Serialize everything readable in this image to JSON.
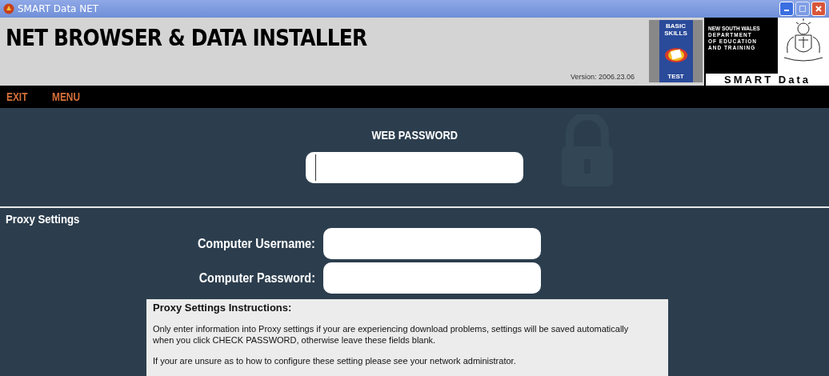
{
  "window": {
    "title": "SMART Data NET"
  },
  "header": {
    "title": "NET BROWSER & DATA INSTALLER",
    "version": "Version: 2006.23.06",
    "badge": {
      "top": "BASIC SKILLS",
      "bottom": "TEST"
    },
    "department": {
      "lines": [
        "NEW SOUTH WALES",
        "DEPARTMENT",
        "OF EDUCATION",
        "AND TRAINING"
      ],
      "product": "SMART Data"
    }
  },
  "menu": [
    "EXIT",
    "MENU"
  ],
  "web_password": {
    "label": "WEB PASSWORD",
    "focused": true
  },
  "proxy": {
    "heading": "Proxy Settings",
    "fields": [
      {
        "label": "Computer Username:"
      },
      {
        "label": "Computer Password:"
      }
    ],
    "instructions": {
      "title": "Proxy Settings Instructions:",
      "paragraphs": [
        "Only enter information into Proxy settings if your are experiencing download problems, settings will be saved automatically when you click CHECK PASSWORD, otherwise leave these fields blank.",
        "If your are unsure as to how to configure these setting please see your network administrator."
      ]
    }
  }
}
